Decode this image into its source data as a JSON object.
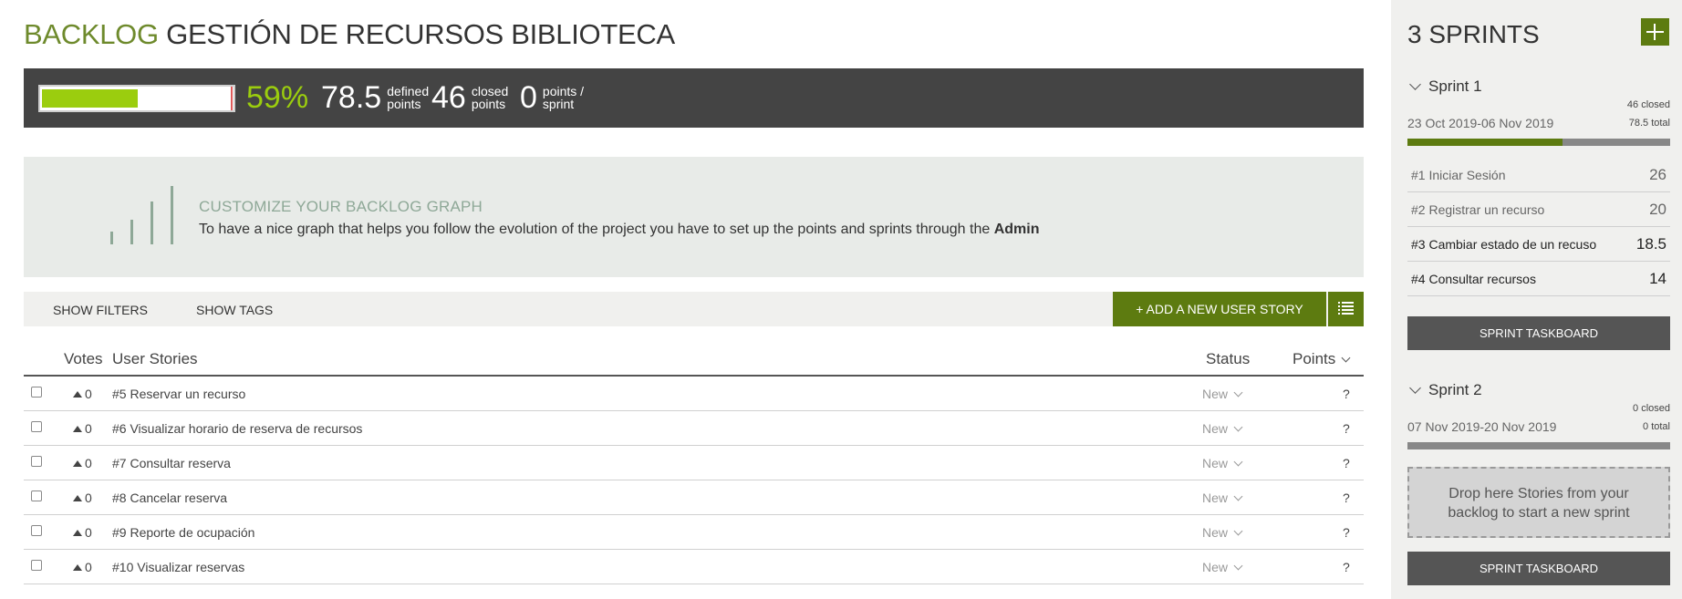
{
  "header": {
    "keyword": "BACKLOG",
    "project": "GESTIÓN DE RECURSOS BIBLIOTECA"
  },
  "summary": {
    "progress_fraction": 0.59,
    "percent": "59%",
    "defined_value": "78.5",
    "defined_label_1": "defined",
    "defined_label_2": "points",
    "closed_value": "46",
    "closed_label_1": "closed",
    "closed_label_2": "points",
    "velocity_value": "0",
    "velocity_label_1": "points /",
    "velocity_label_2": "sprint"
  },
  "graph_hint": {
    "title": "CUSTOMIZE YOUR BACKLOG GRAPH",
    "text": "To have a nice graph that helps you follow the evolution of the project you have to set up the points and sprints through the",
    "link": "Admin"
  },
  "toolbar": {
    "show_filters": "SHOW FILTERS",
    "show_tags": "SHOW TAGS",
    "add_story": "+ ADD A NEW USER STORY",
    "view_icon": "list-view-icon"
  },
  "table": {
    "headers": {
      "votes": "Votes",
      "stories": "User Stories",
      "status": "Status",
      "points": "Points"
    },
    "rows": [
      {
        "votes": "0",
        "title": "#5 Reservar un recurso",
        "status": "New",
        "points": "?"
      },
      {
        "votes": "0",
        "title": "#6 Visualizar horario de reserva de recursos",
        "status": "New",
        "points": "?"
      },
      {
        "votes": "0",
        "title": "#7 Consultar reserva",
        "status": "New",
        "points": "?"
      },
      {
        "votes": "0",
        "title": "#8 Cancelar reserva",
        "status": "New",
        "points": "?"
      },
      {
        "votes": "0",
        "title": "#9 Reporte de ocupación",
        "status": "New",
        "points": "?"
      },
      {
        "votes": "0",
        "title": "#10 Visualizar reservas",
        "status": "New",
        "points": "?"
      }
    ]
  },
  "sidebar": {
    "title": "3 SPRINTS",
    "add_icon": "plus-icon",
    "sprints": [
      {
        "name": "Sprint 1",
        "closed": "46 closed",
        "dates": "23 Oct 2019-06 Nov 2019",
        "total": "78.5 total",
        "progress_fraction": 0.59,
        "stories": [
          {
            "title": "#1 Iniciar Sesión",
            "points": "26"
          },
          {
            "title": "#2 Registrar un recurso",
            "points": "20"
          },
          {
            "title": "#3 Cambiar estado de un recuso",
            "points": "18.5"
          },
          {
            "title": "#4 Consultar recursos",
            "points": "14"
          }
        ],
        "taskboard": "SPRINT TASKBOARD"
      },
      {
        "name": "Sprint 2",
        "closed": "0 closed",
        "dates": "07 Nov 2019-20 Nov 2019",
        "total": "0 total",
        "progress_fraction": 0,
        "dropzone_1": "Drop here Stories from your",
        "dropzone_2": "backlog to start a new sprint",
        "taskboard": "SPRINT TASKBOARD"
      }
    ]
  },
  "colors": {
    "accent": "#5d7b10",
    "progress": "#9bcd0e",
    "title_green": "#6e8a2c",
    "header_bg": "#444444"
  }
}
